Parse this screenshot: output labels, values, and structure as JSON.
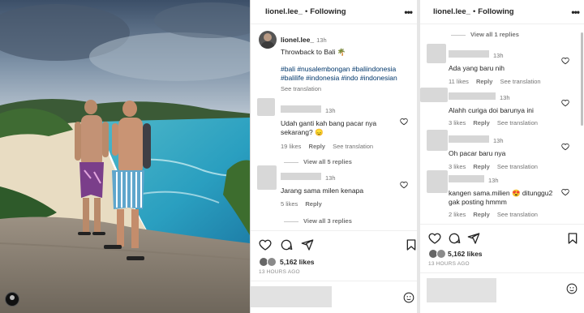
{
  "post": {
    "username": "lionel.lee_",
    "separator": "•",
    "follow_label": "Following",
    "more_icon": "more-horizontal-icon",
    "caption_time": "13h",
    "caption_text": "Throwback to Bali 🌴",
    "hashtags_line1": "#bali #nusalembongan #baliindonesia",
    "hashtags_line2": "#balilife #indonesia #indo #indonesian",
    "see_translation": "See translation",
    "likes": "5,162 likes",
    "ago": "13 HOURS AGO"
  },
  "left_comments": [
    {
      "time": "13h",
      "text_line1": "Udah ganti kah bang pacar nya",
      "text_line2": "sekarang? 😞",
      "likes": "19 likes",
      "reply": "Reply",
      "translation": "See translation",
      "view_replies": "View all 5 replies"
    },
    {
      "time": "13h",
      "text_line1": "Jarang sama milen kenapa",
      "likes": "5 likes",
      "reply": "Reply",
      "view_replies": "View all 3 replies"
    }
  ],
  "right_panel": {
    "view_replies_top": "View all 1 replies",
    "comments": [
      {
        "time": "13h",
        "text": "Ada yang baru nih",
        "likes": "11 likes",
        "reply": "Reply",
        "translation": "See translation"
      },
      {
        "time": "13h",
        "text": "Alahh curiga doi barunya ini",
        "likes": "3 likes",
        "reply": "Reply",
        "translation": "See translation"
      },
      {
        "time": "13h",
        "text": "Oh pacar baru nya",
        "likes": "3 likes",
        "reply": "Reply",
        "translation": "See translation"
      },
      {
        "time": "13h",
        "text_line1": "kangen sama.milien 😍  ditunggu2",
        "text_line2": "gak posting hmmm",
        "likes": "2 likes",
        "reply": "Reply",
        "translation": "See translation"
      }
    ]
  },
  "colors": {
    "link": "#00376b",
    "muted": "#737373",
    "text": "#262626",
    "border": "#efefef"
  }
}
